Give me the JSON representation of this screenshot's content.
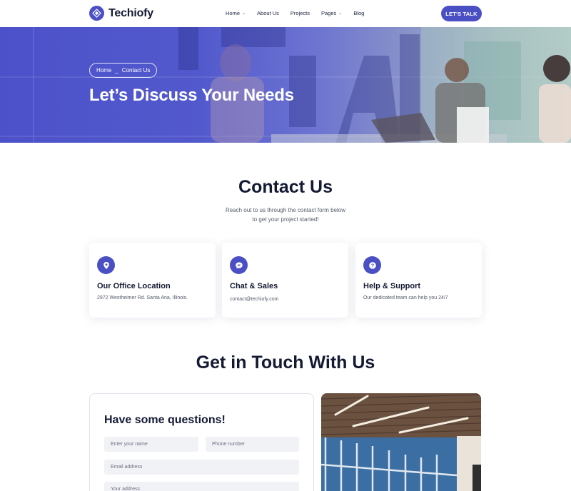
{
  "header": {
    "brand": "Techiofy",
    "nav": [
      {
        "label": "Home",
        "dropdown": true
      },
      {
        "label": "About Us",
        "dropdown": false
      },
      {
        "label": "Projects",
        "dropdown": false
      },
      {
        "label": "Pages",
        "dropdown": true
      },
      {
        "label": "Blog",
        "dropdown": false
      }
    ],
    "cta_label": "LET'S TALK"
  },
  "hero": {
    "breadcrumb_home": "Home",
    "breadcrumb_sep": "_",
    "breadcrumb_current": "Contact Us",
    "title": "Let’s Discuss Your Needs"
  },
  "contact": {
    "title": "Contact Us",
    "subtitle_line1": "Reach out to us through the contact form below",
    "subtitle_line2": "to get your project started!",
    "cards": [
      {
        "icon": "location-pin-icon",
        "title": "Our Office Location",
        "text": "2972 Westheimer Rd. Santa Ana, Illinois."
      },
      {
        "icon": "chat-bubble-icon",
        "title": "Chat & Sales",
        "text": "contact@techiofy.com"
      },
      {
        "icon": "question-icon",
        "title": "Help & Support",
        "text": "Our dedicated team can help you 24/7"
      }
    ]
  },
  "touch": {
    "title": "Get in Touch With Us",
    "form": {
      "heading": "Have some questions!",
      "name_placeholder": "Enter your name",
      "phone_placeholder": "Phone number",
      "email_placeholder": "Email address",
      "address_placeholder": "Your address"
    }
  },
  "colors": {
    "accent": "#4b4fc4",
    "heading": "#141a33"
  }
}
